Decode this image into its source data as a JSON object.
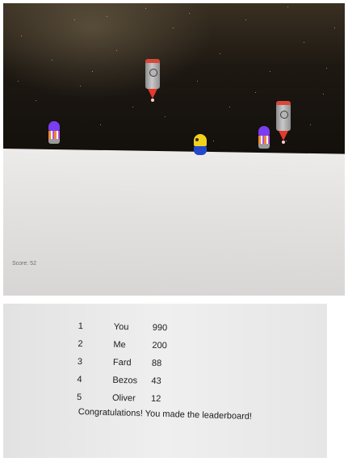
{
  "game": {
    "score_label": "Score: 52"
  },
  "icons": {
    "player": "player-sprite-icon",
    "rocket": "rocket-icon",
    "enemy": "purple-enemy-icon"
  },
  "leaderboard": {
    "rows": [
      {
        "rank": "1",
        "name": "You",
        "score": "990"
      },
      {
        "rank": "2",
        "name": "Me",
        "score": "200"
      },
      {
        "rank": "3",
        "name": "Fard",
        "score": "88"
      },
      {
        "rank": "4",
        "name": "Bezos",
        "score": "43"
      },
      {
        "rank": "5",
        "name": "Oliver",
        "score": "12"
      }
    ],
    "message": "Congratulations! You made the leaderboard!"
  },
  "colors": {
    "sky": "#100d0a",
    "ground": "#e2e1e0",
    "player_top": "#f2d21c",
    "player_bottom": "#2249c9",
    "enemy": "#7a3df0",
    "rocket_nose": "#e3392e"
  }
}
